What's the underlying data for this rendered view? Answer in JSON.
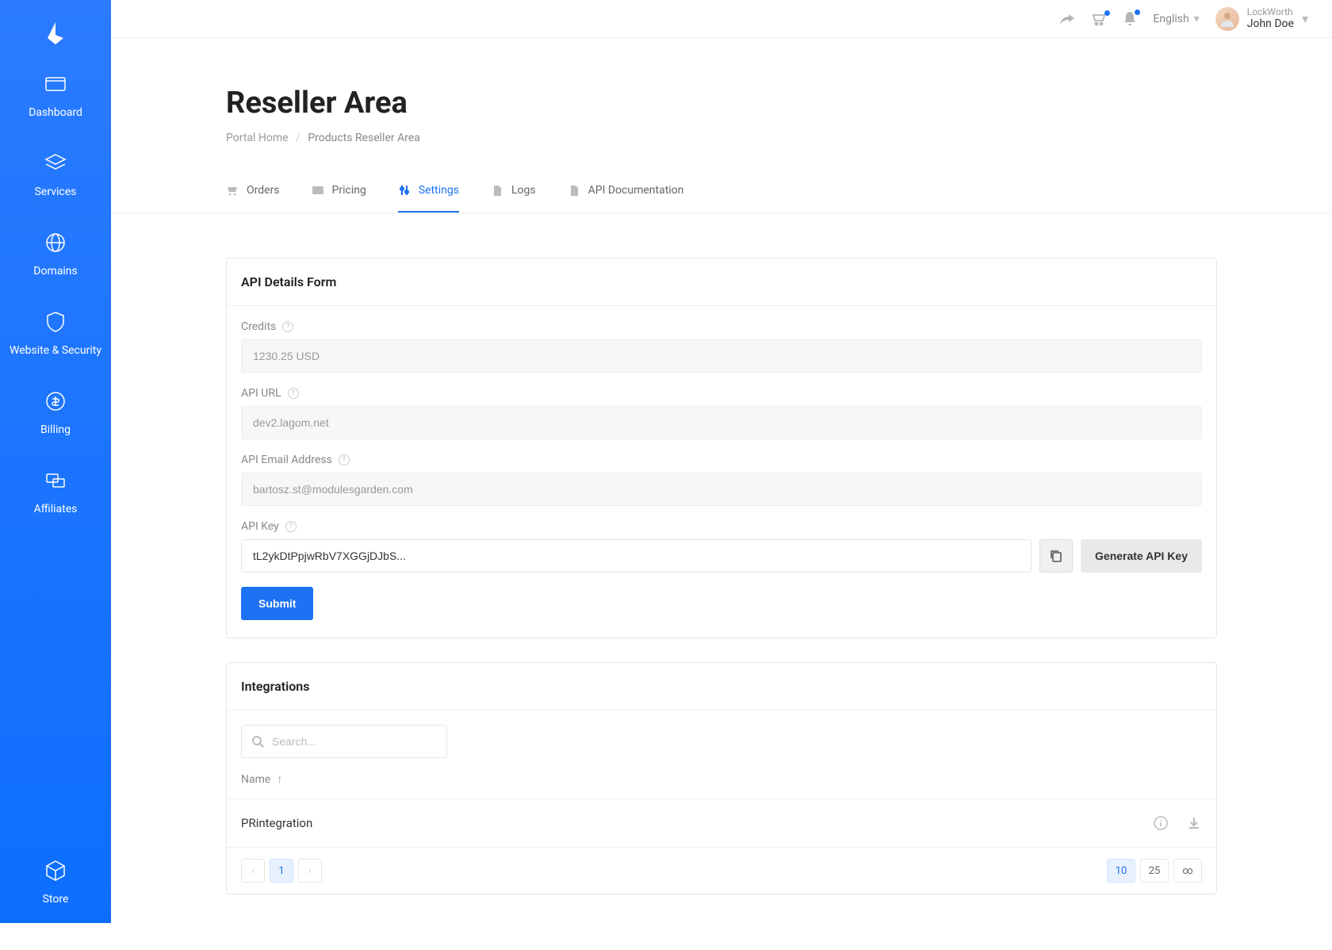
{
  "colors": {
    "accent": "#1d72f3"
  },
  "sidebar": {
    "items": [
      {
        "label": "Dashboard"
      },
      {
        "label": "Services"
      },
      {
        "label": "Domains"
      },
      {
        "label": "Website & Security"
      },
      {
        "label": "Billing"
      },
      {
        "label": "Affiliates"
      }
    ],
    "bottom": {
      "label": "Store"
    }
  },
  "topbar": {
    "language": "English",
    "user_org": "LockWorth",
    "user_name": "John Doe"
  },
  "page": {
    "title": "Reseller Area",
    "breadcrumb_home": "Portal Home",
    "breadcrumb_current": "Products Reseller Area"
  },
  "tabs": [
    {
      "label": "Orders"
    },
    {
      "label": "Pricing"
    },
    {
      "label": "Settings",
      "active": true
    },
    {
      "label": "Logs"
    },
    {
      "label": "API Documentation"
    }
  ],
  "api_form": {
    "title": "API Details Form",
    "fields": {
      "credits": {
        "label": "Credits",
        "value": "1230.25 USD"
      },
      "api_url": {
        "label": "API URL",
        "value": "dev2.lagom.net"
      },
      "api_email": {
        "label": "API Email Address",
        "value": "bartosz.st@modulesgarden.com"
      },
      "api_key": {
        "label": "API Key",
        "value": "tL2ykDtPpjwRbV7XGGjDJbS..."
      }
    },
    "generate_label": "Generate API Key",
    "submit_label": "Submit"
  },
  "integrations": {
    "title": "Integrations",
    "search_placeholder": "Search...",
    "column_name": "Name",
    "rows": [
      {
        "name": "PRintegration"
      }
    ],
    "pagination": {
      "current": "1",
      "sizes": [
        "10",
        "25",
        "∞"
      ],
      "active_size": "10"
    }
  }
}
